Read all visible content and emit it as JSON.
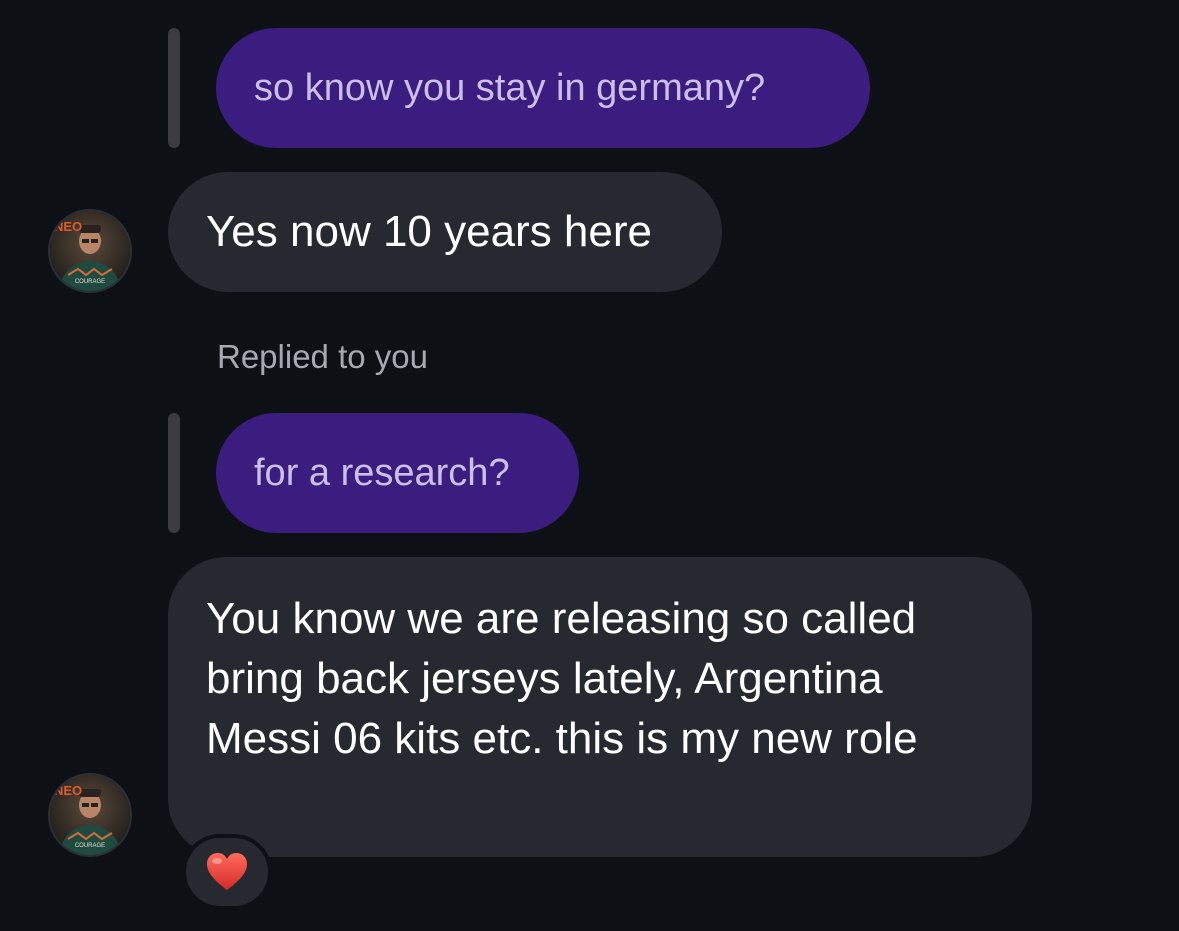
{
  "colors": {
    "background": "#0d1015",
    "own_bubble": "#3b1c7f",
    "own_text": "#cbc0ea",
    "other_bubble": "#26292f",
    "meta_text": "#a6a9b0",
    "reaction_heart": "#e23a3a"
  },
  "thread": {
    "quote_1": "so know you stay in germany?",
    "message_1": "Yes now 10 years here",
    "replied_label": "Replied to you",
    "quote_2": "for a research?",
    "message_2": "You know we are releasing so called bring back jerseys lately, Argentina Messi 06 kits etc. this is my new role",
    "reaction": "heart-emoji"
  },
  "avatar": {
    "logo_text": "NEO",
    "shirt_text": "COURAGE"
  }
}
